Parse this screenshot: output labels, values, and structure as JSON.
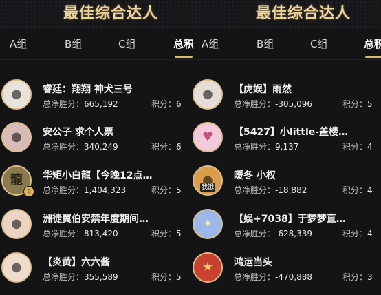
{
  "panels": [
    {
      "title": "最佳综合达人",
      "tabs": [
        "A组",
        "B组",
        "C组",
        "总积"
      ],
      "active_tab": 3,
      "items": [
        {
          "name": "睿廷：翔翔 神犬三号",
          "net_label": "总净胜分：",
          "net_value": "665,192",
          "score_label": "积分：",
          "score_value": "6",
          "avatar_icon": "person-avatar-icon",
          "avatar_color": "#e8e4dc"
        },
        {
          "name": "安公子 求个人票",
          "net_label": "总净胜分：",
          "net_value": "340,249",
          "score_label": "积分：",
          "score_value": "6",
          "avatar_icon": "person-avatar-icon",
          "avatar_color": "#d9bcb8"
        },
        {
          "name": "华矩小白龍【今晚12点…",
          "net_label": "总净胜分：",
          "net_value": "1,404,323",
          "score_label": "积分：",
          "score_value": "5",
          "avatar_icon": "text-logo-avatar-icon",
          "avatar_text": "龍",
          "avatar_color": "#8a7a4e"
        },
        {
          "name": "洲徒翼伯安禁年度期间…",
          "net_label": "总净胜分：",
          "net_value": "813,420",
          "score_label": "积分：",
          "score_value": "5",
          "avatar_icon": "person-avatar-icon",
          "avatar_color": "#ecd4c2"
        },
        {
          "name": "【炎黄】六六酱",
          "net_label": "总净胜分：",
          "net_value": "355,589",
          "score_label": "积分：",
          "score_value": "5",
          "avatar_icon": "person-avatar-icon",
          "avatar_color": "#f0dccc"
        }
      ]
    },
    {
      "title": "最佳综合达人",
      "tabs": [
        "A组",
        "B组",
        "C组",
        "总积"
      ],
      "active_tab": 3,
      "items": [
        {
          "name": "【虎娱】雨然",
          "net_label": "总净胜分：",
          "net_value": "-305,096",
          "score_label": "积分：",
          "score_value": "5",
          "avatar_icon": "person-avatar-icon",
          "avatar_color": "#e6dcd8"
        },
        {
          "name": "【5427】小little-盖楼…",
          "net_label": "总净胜分：",
          "net_value": "9,137",
          "score_label": "积分：",
          "score_value": "4",
          "avatar_icon": "cartoon-avatar-icon",
          "avatar_color": "#f3c9dd"
        },
        {
          "name": "暖冬 小权",
          "net_label": "总净胜分：",
          "net_value": "-18,882",
          "score_label": "积分：",
          "score_value": "4",
          "avatar_icon": "cartoon-avatar-icon",
          "avatar_text": "我饿",
          "avatar_color": "#d99d4c"
        },
        {
          "name": "【娱+7038】于梦梦直…",
          "net_label": "总净胜分：",
          "net_value": "-628,339",
          "score_label": "积分：",
          "score_value": "4",
          "avatar_icon": "anime-avatar-icon",
          "avatar_color": "#9cb8e8"
        },
        {
          "name": "鸿运当头",
          "net_label": "总净胜分：",
          "net_value": "-470,888",
          "score_label": "积分：",
          "score_value": "3",
          "avatar_icon": "lucky-avatar-icon",
          "avatar_color": "#c8402e"
        }
      ]
    }
  ],
  "colors": {
    "background": "#141416",
    "title_gold": "#ecd49a",
    "accent_underline": "#d9b97a",
    "avatar_ring": "#dcc08a"
  }
}
